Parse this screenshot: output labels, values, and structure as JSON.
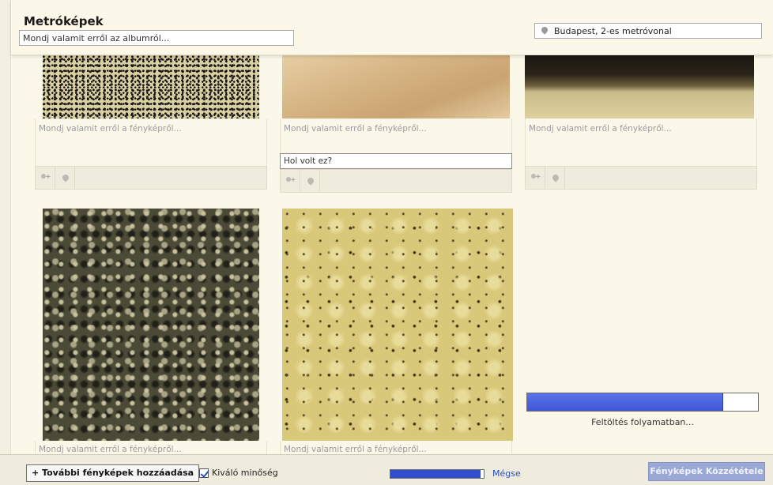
{
  "header": {
    "album_title": "Metróképek",
    "album_description": "Mondj valamit erről az albumról...",
    "location": "Budapest, 2-es metróvonal",
    "location_icon": "pin-icon"
  },
  "photos": [
    {
      "caption_placeholder": "Mondj valamit erről a fényképről...",
      "tag_icon": "tag-person-icon",
      "location_icon": "pin-icon"
    },
    {
      "caption_placeholder": "Mondj valamit erről a fényképről...",
      "where_value": "Hol volt ez?",
      "tag_icon": "tag-person-icon",
      "location_icon": "pin-icon"
    },
    {
      "caption_placeholder": "Mondj valamit erről a fényképről...",
      "tag_icon": "tag-person-icon",
      "location_icon": "pin-icon"
    },
    {
      "caption_placeholder": "Mondj valamit erről a fényképről..."
    },
    {
      "caption_placeholder": "Mondj valamit erről a fényképről..."
    }
  ],
  "upload": {
    "status_label": "Feltöltés folyamatban...",
    "progress": 0.85
  },
  "footer": {
    "add_more_label": "+ További fényképek hozzáadása",
    "high_quality_label": "Kiváló minőség",
    "high_quality_checked": true,
    "overall_progress": 0.97,
    "cancel_label": "Mégse",
    "publish_label": "Fényképek Közzététele"
  },
  "colors": {
    "background": "#fbf8ea",
    "progress_blue": "#3f57d6",
    "publish_button": "#9aa8d6",
    "link": "#2b4fbf"
  }
}
